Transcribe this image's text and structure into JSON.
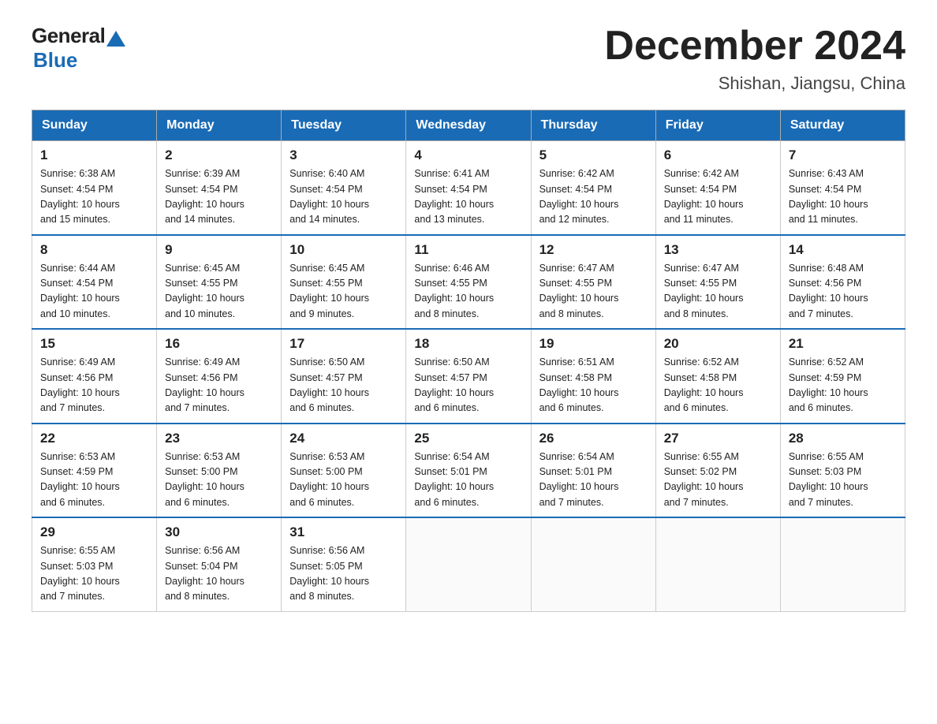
{
  "logo": {
    "general": "General",
    "blue": "Blue"
  },
  "title": "December 2024",
  "subtitle": "Shishan, Jiangsu, China",
  "days_of_week": [
    "Sunday",
    "Monday",
    "Tuesday",
    "Wednesday",
    "Thursday",
    "Friday",
    "Saturday"
  ],
  "weeks": [
    [
      {
        "day": "1",
        "sunrise": "6:38 AM",
        "sunset": "4:54 PM",
        "daylight": "10 hours and 15 minutes."
      },
      {
        "day": "2",
        "sunrise": "6:39 AM",
        "sunset": "4:54 PM",
        "daylight": "10 hours and 14 minutes."
      },
      {
        "day": "3",
        "sunrise": "6:40 AM",
        "sunset": "4:54 PM",
        "daylight": "10 hours and 14 minutes."
      },
      {
        "day": "4",
        "sunrise": "6:41 AM",
        "sunset": "4:54 PM",
        "daylight": "10 hours and 13 minutes."
      },
      {
        "day": "5",
        "sunrise": "6:42 AM",
        "sunset": "4:54 PM",
        "daylight": "10 hours and 12 minutes."
      },
      {
        "day": "6",
        "sunrise": "6:42 AM",
        "sunset": "4:54 PM",
        "daylight": "10 hours and 11 minutes."
      },
      {
        "day": "7",
        "sunrise": "6:43 AM",
        "sunset": "4:54 PM",
        "daylight": "10 hours and 11 minutes."
      }
    ],
    [
      {
        "day": "8",
        "sunrise": "6:44 AM",
        "sunset": "4:54 PM",
        "daylight": "10 hours and 10 minutes."
      },
      {
        "day": "9",
        "sunrise": "6:45 AM",
        "sunset": "4:55 PM",
        "daylight": "10 hours and 10 minutes."
      },
      {
        "day": "10",
        "sunrise": "6:45 AM",
        "sunset": "4:55 PM",
        "daylight": "10 hours and 9 minutes."
      },
      {
        "day": "11",
        "sunrise": "6:46 AM",
        "sunset": "4:55 PM",
        "daylight": "10 hours and 8 minutes."
      },
      {
        "day": "12",
        "sunrise": "6:47 AM",
        "sunset": "4:55 PM",
        "daylight": "10 hours and 8 minutes."
      },
      {
        "day": "13",
        "sunrise": "6:47 AM",
        "sunset": "4:55 PM",
        "daylight": "10 hours and 8 minutes."
      },
      {
        "day": "14",
        "sunrise": "6:48 AM",
        "sunset": "4:56 PM",
        "daylight": "10 hours and 7 minutes."
      }
    ],
    [
      {
        "day": "15",
        "sunrise": "6:49 AM",
        "sunset": "4:56 PM",
        "daylight": "10 hours and 7 minutes."
      },
      {
        "day": "16",
        "sunrise": "6:49 AM",
        "sunset": "4:56 PM",
        "daylight": "10 hours and 7 minutes."
      },
      {
        "day": "17",
        "sunrise": "6:50 AM",
        "sunset": "4:57 PM",
        "daylight": "10 hours and 6 minutes."
      },
      {
        "day": "18",
        "sunrise": "6:50 AM",
        "sunset": "4:57 PM",
        "daylight": "10 hours and 6 minutes."
      },
      {
        "day": "19",
        "sunrise": "6:51 AM",
        "sunset": "4:58 PM",
        "daylight": "10 hours and 6 minutes."
      },
      {
        "day": "20",
        "sunrise": "6:52 AM",
        "sunset": "4:58 PM",
        "daylight": "10 hours and 6 minutes."
      },
      {
        "day": "21",
        "sunrise": "6:52 AM",
        "sunset": "4:59 PM",
        "daylight": "10 hours and 6 minutes."
      }
    ],
    [
      {
        "day": "22",
        "sunrise": "6:53 AM",
        "sunset": "4:59 PM",
        "daylight": "10 hours and 6 minutes."
      },
      {
        "day": "23",
        "sunrise": "6:53 AM",
        "sunset": "5:00 PM",
        "daylight": "10 hours and 6 minutes."
      },
      {
        "day": "24",
        "sunrise": "6:53 AM",
        "sunset": "5:00 PM",
        "daylight": "10 hours and 6 minutes."
      },
      {
        "day": "25",
        "sunrise": "6:54 AM",
        "sunset": "5:01 PM",
        "daylight": "10 hours and 6 minutes."
      },
      {
        "day": "26",
        "sunrise": "6:54 AM",
        "sunset": "5:01 PM",
        "daylight": "10 hours and 7 minutes."
      },
      {
        "day": "27",
        "sunrise": "6:55 AM",
        "sunset": "5:02 PM",
        "daylight": "10 hours and 7 minutes."
      },
      {
        "day": "28",
        "sunrise": "6:55 AM",
        "sunset": "5:03 PM",
        "daylight": "10 hours and 7 minutes."
      }
    ],
    [
      {
        "day": "29",
        "sunrise": "6:55 AM",
        "sunset": "5:03 PM",
        "daylight": "10 hours and 7 minutes."
      },
      {
        "day": "30",
        "sunrise": "6:56 AM",
        "sunset": "5:04 PM",
        "daylight": "10 hours and 8 minutes."
      },
      {
        "day": "31",
        "sunrise": "6:56 AM",
        "sunset": "5:05 PM",
        "daylight": "10 hours and 8 minutes."
      },
      null,
      null,
      null,
      null
    ]
  ],
  "labels": {
    "sunrise": "Sunrise:",
    "sunset": "Sunset:",
    "daylight": "Daylight:"
  }
}
